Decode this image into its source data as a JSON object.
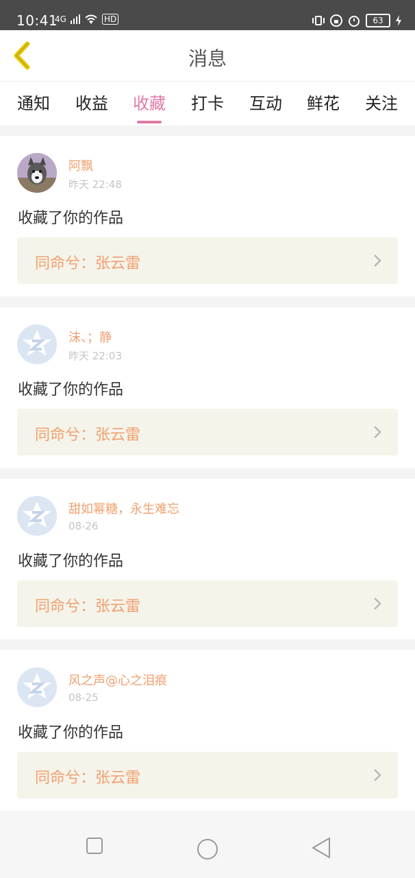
{
  "status_bar": {
    "time": "10:41",
    "network": "4G",
    "hd": "HD",
    "battery": "63"
  },
  "header": {
    "title": "消息"
  },
  "tabs": [
    {
      "label": "通知",
      "active": false
    },
    {
      "label": "收益",
      "active": false
    },
    {
      "label": "收藏",
      "active": true
    },
    {
      "label": "打卡",
      "active": false
    },
    {
      "label": "互动",
      "active": false
    },
    {
      "label": "鲜花",
      "active": false
    },
    {
      "label": "关注",
      "active": false
    }
  ],
  "feed": {
    "items": [
      {
        "name": "阿飘",
        "time": "昨天 22:48",
        "message": "收藏了你的作品",
        "work": "同命兮：张云雷",
        "avatar": "dog-photo"
      },
      {
        "name": "沫、；静",
        "time": "昨天 22:03",
        "message": "收藏了你的作品",
        "work": "同命兮：张云雷",
        "avatar": "default-z"
      },
      {
        "name": "甜如幂糖，永生难忘",
        "time": "08-26",
        "message": "收藏了你的作品",
        "work": "同命兮：张云雷",
        "avatar": "default-z"
      },
      {
        "name": "风之声@心之泪痕",
        "time": "08-25",
        "message": "收藏了你的作品",
        "work": "同命兮：张云雷",
        "avatar": "default-z"
      }
    ]
  },
  "colors": {
    "accent_pink": "#e07aa8",
    "name_orange": "#f0a070",
    "card_work_bg": "#f5f4ea"
  }
}
